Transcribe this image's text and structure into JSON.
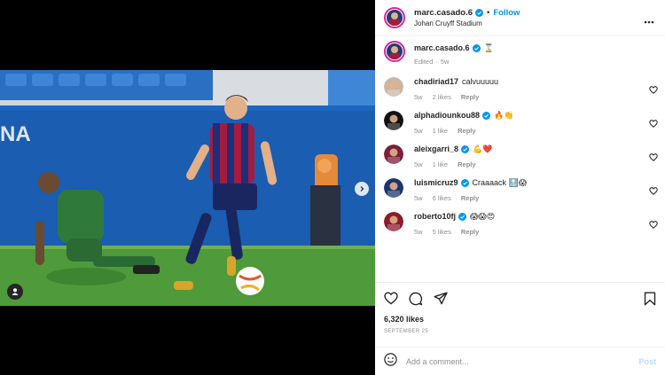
{
  "media": {
    "next_icon": "chevron-right-icon",
    "tag_icon": "user-tag-icon",
    "banner_text": "NA"
  },
  "header": {
    "username": "marc.casado.6",
    "separator": "•",
    "follow_label": "Follow",
    "location": "Johan Cruyff Stadium",
    "more_icon": "more-horizontal-icon"
  },
  "caption": {
    "username": "marc.casado.6",
    "text": "⌛",
    "edited": "Edited",
    "time": "5w"
  },
  "comments": [
    {
      "username": "chadiriad17",
      "verified": false,
      "text": "calvuuuuu",
      "time": "5w",
      "likes": "2 likes",
      "reply": "Reply",
      "avatar_color": "#c9b6a3"
    },
    {
      "username": "alphadiounkou88",
      "verified": true,
      "text": "🔥👏",
      "time": "5w",
      "likes": "1 like",
      "reply": "Reply",
      "avatar_color": "#111111"
    },
    {
      "username": "aleixgarri_8",
      "verified": true,
      "text": "💪❤️",
      "time": "5w",
      "likes": "1 like",
      "reply": "Reply",
      "avatar_color": "#7a1e3a"
    },
    {
      "username": "luismicruz9",
      "verified": true,
      "text": "Craaaack 🔝😱",
      "time": "5w",
      "likes": "6 likes",
      "reply": "Reply",
      "avatar_color": "#1e3470"
    },
    {
      "username": "roberto10fj",
      "verified": true,
      "text": "😱😱😍",
      "time": "5w",
      "likes": "5 likes",
      "reply": "Reply",
      "avatar_color": "#8a1c2c"
    }
  ],
  "actions": {
    "like_icon": "heart-icon",
    "comment_icon": "comment-icon",
    "share_icon": "share-icon",
    "save_icon": "bookmark-icon",
    "likes_text": "6,320 likes",
    "date": "September 25"
  },
  "add_comment": {
    "emoji_icon": "emoji-icon",
    "placeholder": "Add a comment...",
    "post_label": "Post"
  },
  "colors": {
    "accent": "#0095f6",
    "muted": "#8e8e8e",
    "post_disabled": "#b2dffc",
    "story_ring": "#d6249f"
  }
}
